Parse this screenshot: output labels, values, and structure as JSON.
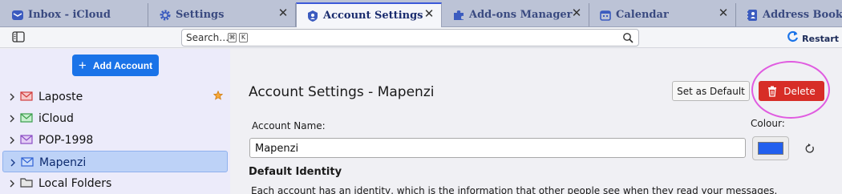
{
  "tabs": [
    {
      "label": "Inbox - iCloud",
      "icon": "inbox-icon"
    },
    {
      "label": "Settings",
      "icon": "gear-icon"
    },
    {
      "label": "Account Settings",
      "icon": "account-settings-icon"
    },
    {
      "label": "Add-ons Manager",
      "icon": "puzzle-icon"
    },
    {
      "label": "Calendar",
      "icon": "calendar-icon"
    },
    {
      "label": "Address Book",
      "icon": "address-book-icon"
    }
  ],
  "toolbar": {
    "search_placeholder": "Search…",
    "shortcut_keys": [
      "⌘",
      "K"
    ],
    "restart_label": "Restart"
  },
  "sidebar": {
    "add_account_label": "Add Account",
    "accounts": [
      {
        "label": "Laposte",
        "icon": "mail-account-red-icon",
        "default": true,
        "selected": false
      },
      {
        "label": "iCloud",
        "icon": "mail-account-green-icon",
        "default": false,
        "selected": false
      },
      {
        "label": "POP-1998",
        "icon": "mail-account-purple-icon",
        "default": false,
        "selected": false
      },
      {
        "label": "Mapenzi",
        "icon": "mail-account-blue-icon",
        "default": false,
        "selected": true
      },
      {
        "label": "Local Folders",
        "icon": "folder-icon",
        "default": false,
        "selected": false
      }
    ]
  },
  "main": {
    "title": "Account Settings - Mapenzi",
    "set_default_label": "Set as Default",
    "delete_label": "Delete",
    "account_name_label": "Account Name:",
    "account_name_value": "Mapenzi",
    "colour_label": "Colour:",
    "colour_value": "#2260ee",
    "default_identity_title": "Default Identity",
    "default_identity_desc": "Each account has an identity, which is the information that other people see when they read your messages."
  },
  "colors": {
    "accent": "#1a73e8",
    "delete": "#d72d27",
    "highlight": "#e05be0",
    "tab_text": "#3a4a80"
  }
}
